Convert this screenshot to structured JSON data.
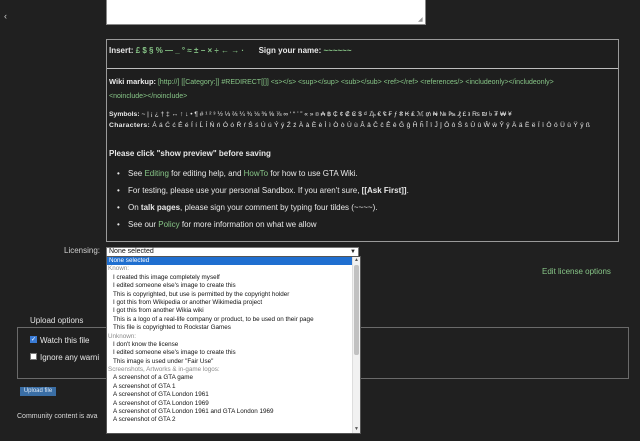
{
  "icons": {
    "left_arrow": "chevron-left-icon",
    "resize": "resize-grip-icon",
    "select_arrow": "chevron-down-icon"
  },
  "colors": {
    "background": "#202020",
    "link": "#87c587",
    "selected": "#1f6fd0",
    "button": "#3a6ea5"
  },
  "editor": {
    "insert_label": "Insert:",
    "insert_chars": "£ $ § % — _ ° ≈ ± − × ÷ ← → ·",
    "signature_label": "Sign your name:",
    "signature_value": "~~~~~~",
    "wiki_label": "Wiki markup:",
    "wiki_items": "[http://]   [[Category:]]   #REDIRECT[[]]   <s></s>   <sup></sup>   <sub></sub>   <ref></ref>   <references/>   <includeonly></includeonly>",
    "wiki_items2": "<noinclude></noinclude>",
    "symbols_label": "Symbols:",
    "symbols_value": "~ | ¡ ¿ † ‡ ↔ ↑ ↓ • ¶ # ¹ ² ³ ½ ⅓ ⅔ ¼ ¾ ⅛ ⅜ ⅝ ⅞ ∞ ‘ “ ’ ” « » ¤ ₳ ฿ ₵ ¢ ₡ ₢ $ ₫ ₯ € ₠ ₣ ƒ ₴ ₭ ₤ ℳ ₥ ₦ № ₧ ₰ £ ៛ ₨ ₪ ৳ ₮ ₩ ¥",
    "chars_label": "Characters:",
    "chars_value": "Á á Ć ć É é Í í Ĺ ĺ Ń ń Ó ó Ŕ ŕ Ś ś Ú ú Ý ý Ź ź  À à È è Ì ì Ò ò Ù ù  Â â Ĉ ĉ Ê ê Ĝ ĝ Ĥ ĥ Î î Ĵ ĵ Ô ô Ŝ ŝ Û û Ŵ ŵ Ŷ ŷ  Ä ä Ë ë Ï ï Ö ö Ü ü Ÿ ÿ  ß",
    "preview_notice": "Please click \"show preview\" before saving",
    "help": {
      "see": "See ",
      "editing_link": "Editing",
      "for_editing": " for editing help, and ",
      "howto_link": "HowTo",
      "for_howto": " for how to use GTA Wiki.",
      "testing": "For testing, please use your personal Sandbox. If you aren't sure, ",
      "ask_first": "[[Ask First]]",
      "testing_end": ".",
      "on": "On ",
      "talk_pages": "talk pages",
      "talk_rest": ", please sign your comment by typing four tildes (~~~~).",
      "see_our": "See our ",
      "policy_link": "Policy",
      "policy_rest": " for more information on what we allow"
    }
  },
  "licensing": {
    "label": "Licensing:",
    "selected": "None selected",
    "edit_link": "Edit license options",
    "options": [
      {
        "label": "None selected",
        "kind": "sel"
      },
      {
        "label": "Known:",
        "kind": "grp"
      },
      {
        "label": "I created this image completely myself",
        "kind": "opt"
      },
      {
        "label": "I edited someone else's image to create this",
        "kind": "opt"
      },
      {
        "label": "This is copyrighted, but use is permitted by the copyright holder",
        "kind": "opt"
      },
      {
        "label": "I got this from Wikipedia or another Wikimedia project",
        "kind": "opt"
      },
      {
        "label": "I got this from another Wikia wiki",
        "kind": "opt"
      },
      {
        "label": "This is a logo of a real-life company or product, to be used on their page",
        "kind": "opt"
      },
      {
        "label": "This file is copyrighted to Rockstar Games",
        "kind": "opt"
      },
      {
        "label": "Unknown:",
        "kind": "grp"
      },
      {
        "label": "I don't know the license",
        "kind": "opt"
      },
      {
        "label": "I edited someone else's image to create this",
        "kind": "opt"
      },
      {
        "label": "This image is used under \"Fair Use\"",
        "kind": "opt"
      },
      {
        "label": "Screenshots, Artworks & in-game logos:",
        "kind": "grp"
      },
      {
        "label": "A screenshot of a GTA game",
        "kind": "opt"
      },
      {
        "label": "A screenshot of GTA 1",
        "kind": "opt"
      },
      {
        "label": "A screenshot of GTA London 1961",
        "kind": "opt"
      },
      {
        "label": "A screenshot of GTA London 1969",
        "kind": "opt"
      },
      {
        "label": "A screenshot of GTA London 1961 and GTA London 1969",
        "kind": "opt"
      },
      {
        "label": "A screenshot of GTA 2",
        "kind": "opt"
      }
    ]
  },
  "upload": {
    "legend": "Upload options",
    "watch_label": "Watch this file",
    "ignore_label": "Ignore any warni",
    "button_label": "Upload file",
    "community_text": "Community content is ava"
  }
}
